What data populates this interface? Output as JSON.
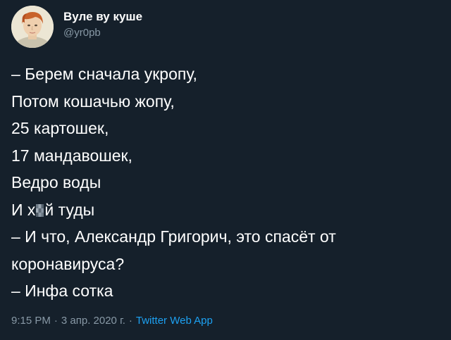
{
  "author": {
    "display_name": "Вуле ву куше",
    "handle": "@yr0pb"
  },
  "tweet": {
    "lines": [
      "– Берем сначала укропу,",
      "Потом кошачью жопу,",
      "25 картошек,",
      "17 мандавошек,",
      "Ведро воды",
      {
        "before": "И х",
        "censored": "у",
        "after": "й туды"
      },
      "– И что, Александр Григорич, это спасёт от",
      "коронавируса?",
      "– Инфа сотка"
    ]
  },
  "meta": {
    "time": "9:15 PM",
    "separator": "·",
    "date": "3 апр. 2020 г.",
    "source": "Twitter Web App"
  },
  "colors": {
    "background": "#15202b",
    "text": "#ffffff",
    "secondary": "#8899a6",
    "link": "#1da1f2"
  }
}
